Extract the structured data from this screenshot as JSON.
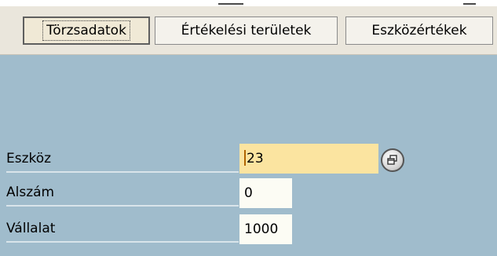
{
  "tabs": [
    {
      "label": "Törzsadatok",
      "active": true
    },
    {
      "label": "Értékelési területek",
      "active": false
    },
    {
      "label": "Eszközértékek",
      "active": false
    }
  ],
  "form": {
    "rows": [
      {
        "label": "Eszköz",
        "value": "23",
        "focused": true,
        "has_value_help": true
      },
      {
        "label": "Alszám",
        "value": "0",
        "focused": false
      },
      {
        "label": "Vállalat",
        "value": "1000",
        "focused": false
      }
    ],
    "value_help_icon": "possible-entries-icon"
  },
  "colors": {
    "background": "#a0bccc",
    "toolbar": "#eae6dc",
    "focused_field": "#fbe4a0",
    "plain_field": "#fcfcf4"
  }
}
